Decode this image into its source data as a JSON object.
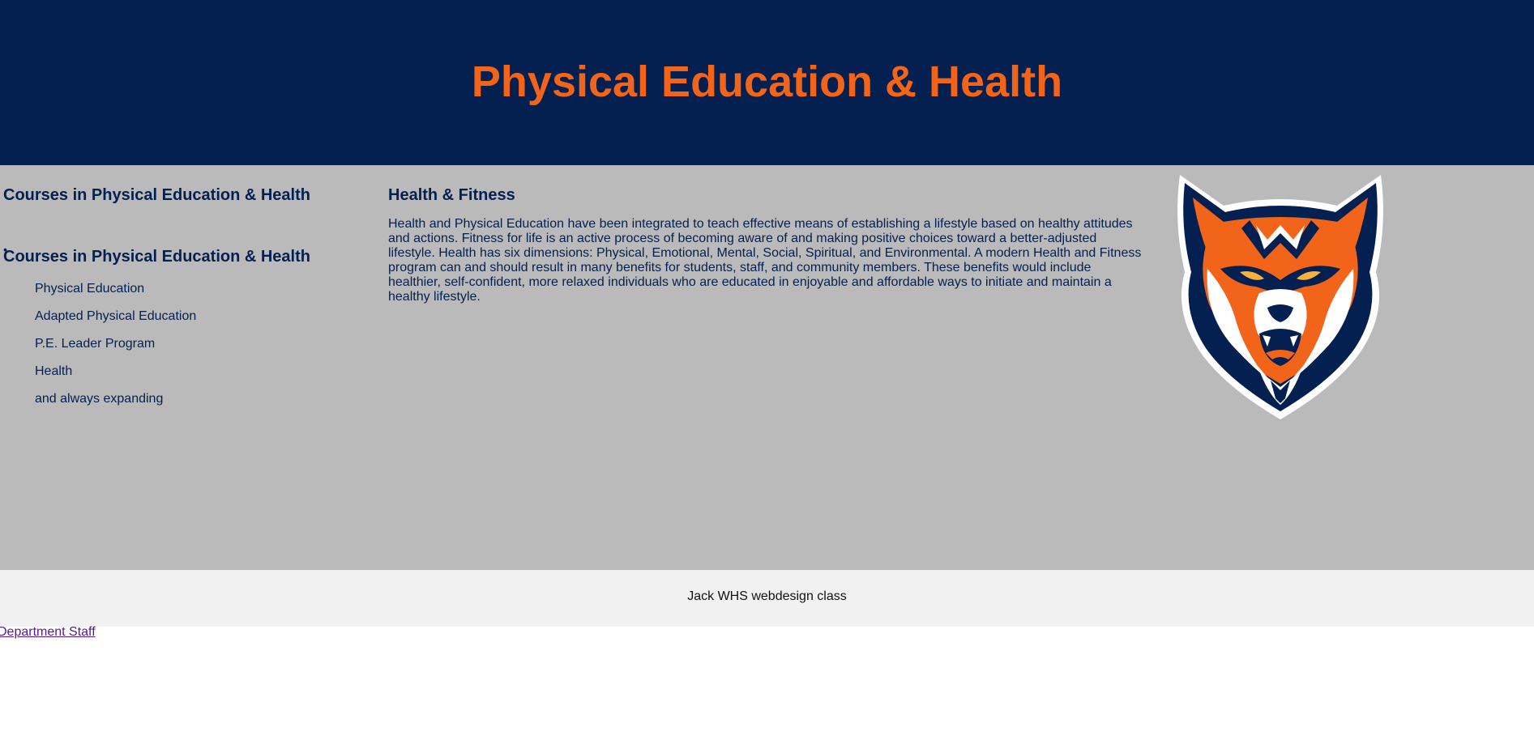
{
  "header": {
    "title": "Physical Education & Health"
  },
  "sidebar": {
    "heading": "Courses in Physical Education & Health",
    "bullet": "•",
    "subheading": "Courses in Physical Education & Health",
    "courses": [
      "Physical Education",
      "Adapted Physical Education",
      "P.E. Leader Program",
      "Health",
      "and always expanding"
    ]
  },
  "article": {
    "heading": "Health & Fitness",
    "body": "Health and Physical Education have been integrated to teach effective means of establishing a lifestyle based on healthy attitudes and actions. Fitness for life is an active process of becoming aware of and making positive choices toward a better-adjusted lifestyle. Health has six dimensions: Physical, Emotional, Mental, Social, Spiritual, and Environmental. A modern Health and Fitness program can and should result in many benefits for students, staff, and community members. These benefits would include healthier, self-confident, more relaxed individuals who are educated in enjoyable and affordable ways to initiate and maintain a healthy lifestyle."
  },
  "mascot": {
    "icon": "wolf-mascot-logo",
    "colors": {
      "navy": "#042050",
      "orange": "#f26419",
      "white": "#ffffff"
    }
  },
  "footer": {
    "text": "Jack WHS webdesign class"
  },
  "links": {
    "department_staff": "Department Staff"
  },
  "colors": {
    "header_bg": "#042050",
    "title": "#f26419",
    "main_bg": "#bababa",
    "footer_bg": "#f1f1f1",
    "link": "#551a8b"
  }
}
